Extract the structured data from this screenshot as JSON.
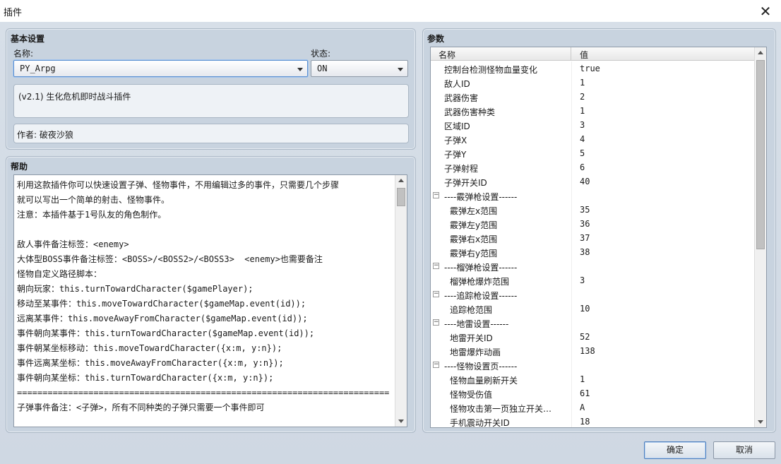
{
  "window": {
    "title": "插件"
  },
  "basic": {
    "title": "基本设置",
    "name_label": "名称:",
    "name_value": "PY_Arpg",
    "status_label": "状态:",
    "status_value": "ON",
    "description": "(v2.1) 生化危机即时战斗插件",
    "author": "作者: 破夜沙狼"
  },
  "help": {
    "title": "帮助",
    "lines": [
      "利用这款插件你可以快速设置子弹、怪物事件，不用编辑过多的事件，只需要几个步骤",
      "就可以写出一个简单的射击、怪物事件。",
      "注意：本插件基于1号队友的角色制作。",
      "",
      "敌人事件备注标签：<enemy>",
      "大体型BOSS事件备注标签：<BOSS>/<BOSS2>/<BOSS3>  <enemy>也需要备注",
      "怪物自定义路径脚本：",
      "朝向玩家：this.turnTowardCharacter($gamePlayer);",
      "移动至某事件：this.moveTowardCharacter($gameMap.event(id));",
      "远离某事件：this.moveAwayFromCharacter($gameMap.event(id));",
      "事件朝向某事件：this.turnTowardCharacter($gameMap.event(id));",
      "事件朝某坐标移动：this.moveTowardCharacter({x:m, y:n});",
      "事件远离某坐标：this.moveAwayFromCharacter({x:m, y:n});",
      "事件朝向某坐标：this.turnTowardCharacter({x:m, y:n});",
      "=========================================================================",
      "子弹事件备注：<子弹>，所有不同种类的子弹只需要一个事件即可"
    ]
  },
  "params": {
    "title": "参数",
    "col_name": "名称",
    "col_value": "值",
    "rows": [
      {
        "name": "控制台检测怪物血量变化",
        "value": "true",
        "kind": "top"
      },
      {
        "name": "敌人ID",
        "value": "1",
        "kind": "top"
      },
      {
        "name": "武器伤害",
        "value": "2",
        "kind": "top"
      },
      {
        "name": "武器伤害种类",
        "value": "1",
        "kind": "top"
      },
      {
        "name": "区域ID",
        "value": "3",
        "kind": "top"
      },
      {
        "name": "子弹X",
        "value": "4",
        "kind": "top"
      },
      {
        "name": "子弹Y",
        "value": "5",
        "kind": "top"
      },
      {
        "name": "子弹射程",
        "value": "6",
        "kind": "top"
      },
      {
        "name": "子弹开关ID",
        "value": "40",
        "kind": "top"
      },
      {
        "name": "----霰弹枪设置------",
        "value": "",
        "kind": "group",
        "toggle": "−"
      },
      {
        "name": "霰弹左x范围",
        "value": "35",
        "kind": "sub"
      },
      {
        "name": "霰弹左y范围",
        "value": "36",
        "kind": "sub"
      },
      {
        "name": "霰弹右x范围",
        "value": "37",
        "kind": "sub"
      },
      {
        "name": "霰弹右y范围",
        "value": "38",
        "kind": "sub"
      },
      {
        "name": "----榴弹枪设置------",
        "value": "",
        "kind": "group",
        "toggle": "−"
      },
      {
        "name": "榴弹枪爆炸范围",
        "value": "3",
        "kind": "sub"
      },
      {
        "name": "----追踪枪设置------",
        "value": "",
        "kind": "group",
        "toggle": "−"
      },
      {
        "name": "追踪枪范围",
        "value": "10",
        "kind": "sub"
      },
      {
        "name": "----地雷设置------",
        "value": "",
        "kind": "group",
        "toggle": "−"
      },
      {
        "name": "地雷开关ID",
        "value": "52",
        "kind": "sub"
      },
      {
        "name": "地雷爆炸动画",
        "value": "138",
        "kind": "sub"
      },
      {
        "name": "----怪物设置页------",
        "value": "",
        "kind": "group",
        "toggle": "−"
      },
      {
        "name": "怪物血量刷新开关",
        "value": "1",
        "kind": "sub"
      },
      {
        "name": "怪物受伤值",
        "value": "61",
        "kind": "sub"
      },
      {
        "name": "怪物攻击第一页独立开关…",
        "value": "A",
        "kind": "sub"
      },
      {
        "name": "手机震动开关ID",
        "value": "18",
        "kind": "sub"
      }
    ]
  },
  "buttons": {
    "ok": "确定",
    "cancel": "取消"
  },
  "icons": {
    "close": "close-icon",
    "dropdown": "chevron-down-icon",
    "collapse": "minus-box-icon"
  },
  "colors": {
    "panel": "#c8d3df",
    "background": "#d3dce6",
    "focus": "#5a8fd0"
  }
}
